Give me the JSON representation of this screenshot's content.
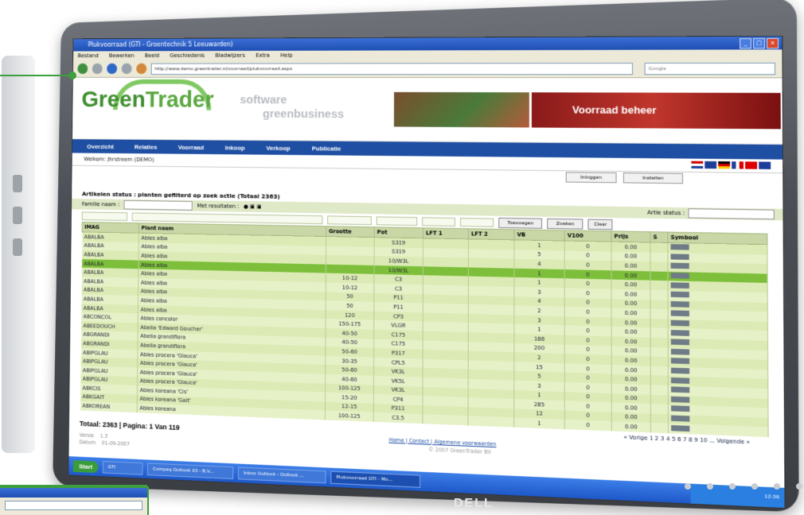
{
  "window": {
    "title": "Plukvoorraad (GTI - Groentechnik 5 Leeuwarden)",
    "menu": [
      "Bestand",
      "Bewerken",
      "Beeld",
      "Geschiedenis",
      "Bladwijzers",
      "Extra",
      "Help"
    ],
    "url": "http://www.demo.greentrader.nl/voorraad/plukvoorraad.aspx",
    "search_placeholder": "Google"
  },
  "header": {
    "logo_green": "Green",
    "logo_trader": "Trader",
    "tagline_line1": "software",
    "tagline_line2": "greenbusiness",
    "banner_text": "Voorraad beheer"
  },
  "nav": [
    "Overzicht",
    "Relaties",
    "Voorraad",
    "Inkoop",
    "Verkoop",
    "Publicatie"
  ],
  "welcome": "Welkom: Jhrstreem (DEMO)",
  "buttons": {
    "login": "Inloggen",
    "save": "Instellen"
  },
  "status_line": "Artikelen status : planten gefilterd op zoek actie (Totaal 2363)",
  "filters": {
    "family_label": "Familie naam :",
    "results_label": "Met resultaten :",
    "art_status_label": "Artie status :",
    "search_button": "Toevoegen",
    "apply_button": "Zoeken",
    "clear_button": "Clear"
  },
  "table": {
    "columns": [
      "IMAG",
      "Plant naam",
      "Grootte",
      "Pot",
      "LFT 1",
      "LFT 2",
      "VB",
      "V100",
      "Prijs",
      "S",
      "Symbool"
    ],
    "rows": [
      {
        "code": "ABALBA",
        "name": "Abies alba",
        "size": "",
        "pot": "S319",
        "vb": "1",
        "v100": "0",
        "price": "0.00"
      },
      {
        "code": "ABALBA",
        "name": "Abies alba",
        "size": "",
        "pot": "S319",
        "vb": "5",
        "v100": "0",
        "price": "0.00"
      },
      {
        "code": "ABALBA",
        "name": "Abies alba",
        "size": "",
        "pot": "10/W3L",
        "vb": "4",
        "v100": "0",
        "price": "0.00"
      },
      {
        "code": "ABALBA",
        "name": "Abies alba",
        "size": "",
        "pot": "10/W3L",
        "vb": "1",
        "v100": "0",
        "price": "0.00"
      },
      {
        "code": "ABALBA",
        "name": "Abies alba",
        "size": "10-12",
        "pot": "C3",
        "vb": "1",
        "v100": "0",
        "price": "0.00"
      },
      {
        "code": "ABALBA",
        "name": "Abies alba",
        "size": "10-12",
        "pot": "C3",
        "vb": "3",
        "v100": "0",
        "price": "0.00"
      },
      {
        "code": "ABALBA",
        "name": "Abies alba",
        "size": "50",
        "pot": "P11",
        "vb": "4",
        "v100": "0",
        "price": "0.00"
      },
      {
        "code": "ABALBA",
        "name": "Abies alba",
        "size": "50",
        "pot": "P11",
        "vb": "2",
        "v100": "0",
        "price": "0.00"
      },
      {
        "code": "ABALBA",
        "name": "Abies alba",
        "size": "120",
        "pot": "CP3",
        "vb": "3",
        "v100": "0",
        "price": "0.00"
      },
      {
        "code": "ABCONCOL",
        "name": "Abies concolor",
        "size": "150-175",
        "pot": "VLGR",
        "vb": "1",
        "v100": "0",
        "price": "0.00"
      },
      {
        "code": "ABEEDOUCH",
        "name": "Abelia 'Edward Goucher'",
        "size": "40-50",
        "pot": "C175",
        "vb": "186",
        "v100": "0",
        "price": "0.00"
      },
      {
        "code": "ABGRANDI",
        "name": "Abelia grandiflora",
        "size": "40-50",
        "pot": "C175",
        "vb": "200",
        "v100": "0",
        "price": "0.00"
      },
      {
        "code": "ABGRANDI",
        "name": "Abelia grandiflora",
        "size": "50-60",
        "pot": "P317",
        "vb": "2",
        "v100": "0",
        "price": "0.00"
      },
      {
        "code": "ABIPGLAU",
        "name": "Abies procera 'Glauca'",
        "size": "30-35",
        "pot": "CPL5",
        "vb": "15",
        "v100": "0",
        "price": "0.00"
      },
      {
        "code": "ABIPGLAU",
        "name": "Abies procera 'Glauca'",
        "size": "50-60",
        "pot": "VK3L",
        "vb": "5",
        "v100": "0",
        "price": "0.00"
      },
      {
        "code": "ABIPGLAU",
        "name": "Abies procera 'Glauca'",
        "size": "40-60",
        "pot": "VK5L",
        "vb": "3",
        "v100": "0",
        "price": "0.00"
      },
      {
        "code": "ABIPGLAU",
        "name": "Abies procera 'Glauca'",
        "size": "100-125",
        "pot": "VK3L",
        "vb": "1",
        "v100": "0",
        "price": "0.00"
      },
      {
        "code": "ABKCIS",
        "name": "Abies koreana 'Cis'",
        "size": "15-20",
        "pot": "CP4",
        "vb": "285",
        "v100": "0",
        "price": "0.00"
      },
      {
        "code": "ABKGAIT",
        "name": "Abies koreana 'Gait'",
        "size": "12-15",
        "pot": "P311",
        "vb": "12",
        "v100": "0",
        "price": "0.00"
      },
      {
        "code": "ABKOREAN",
        "name": "Abies koreana",
        "size": "100-125",
        "pot": "C3.5",
        "vb": "1",
        "v100": "0",
        "price": "0.00"
      }
    ]
  },
  "pager": "« Vorige 1 2 3 4 5 6 7 8 9 10 ... Volgende »",
  "footer": {
    "total": "Totaal: 2363 | Pagina: 1 Van 119",
    "version_label": "Versie",
    "version": "1.3",
    "date_label": "Datum",
    "date": "01-09-2007",
    "links": "Home | Contact | Algemene voorwaarden",
    "copyright": "© 2007 GreenTrader BV"
  },
  "taskbar": {
    "start": "Start",
    "tasks": [
      "GTI",
      "Compaq Outlook 03 - B.V...",
      "Inbox Outlook - Outlook ...",
      "Plukvoorraad GTI - Mo..."
    ],
    "clock": "12:36"
  },
  "monitor_brand": "DELL",
  "colors": {
    "accent_green": "#3d9f3d",
    "nav_blue": "#1f4fa3",
    "row_green": "#dcebb6",
    "selected_row": "#7dbf3a"
  }
}
